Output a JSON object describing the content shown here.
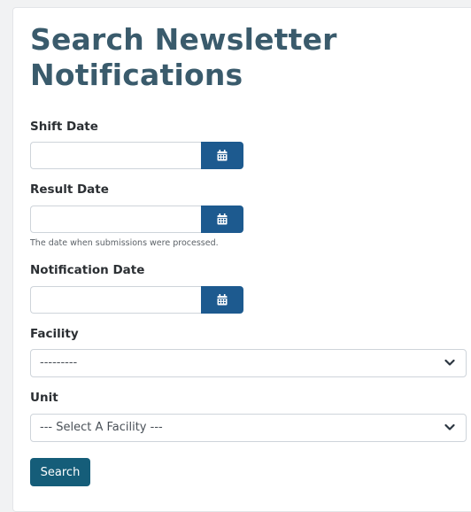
{
  "page": {
    "title": "Search Newsletter Notifications"
  },
  "fields": {
    "shift_date": {
      "label": "Shift Date",
      "value": ""
    },
    "result_date": {
      "label": "Result Date",
      "value": "",
      "help": "The date when submissions were processed."
    },
    "notification_date": {
      "label": "Notification Date",
      "value": ""
    },
    "facility": {
      "label": "Facility",
      "selected": "---------"
    },
    "unit": {
      "label": "Unit",
      "selected": "--- Select A Facility ---"
    }
  },
  "actions": {
    "search_label": "Search"
  },
  "icons": {
    "calendar": "calendar-icon",
    "chevron": "chevron-down-icon"
  },
  "colors": {
    "title": "#3a5b6c",
    "calendar_button": "#1d5a8f",
    "search_button": "#155d79"
  }
}
